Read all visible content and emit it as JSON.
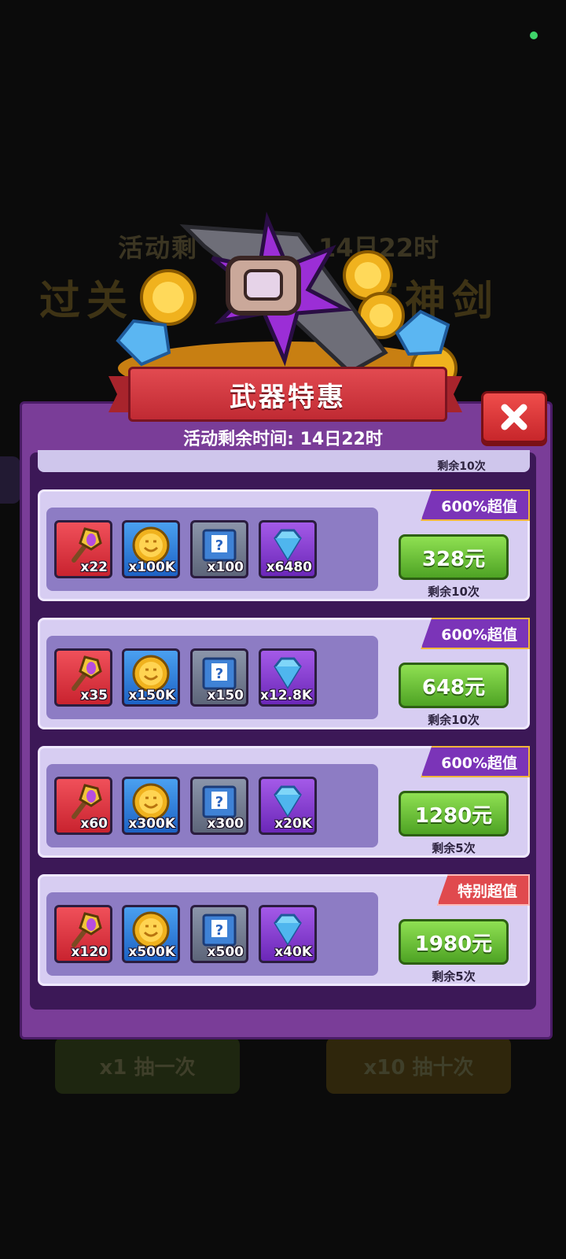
{
  "background": {
    "event_subtitle_left": "活动剩",
    "event_subtitle_right": "14日22时",
    "event_title_left": "过关",
    "event_title_right": "享神剑",
    "draw_one_label": "x1 抽一次",
    "draw_ten_label": "x10 抽十次"
  },
  "dialog": {
    "title": "武器特惠",
    "timer_text": "活动剩余时间: 14日22时",
    "partial_top_remaining": "剩余10次",
    "offers": [
      {
        "badge": "600%超值",
        "items": [
          {
            "icon": "staff-icon",
            "qty": "x22"
          },
          {
            "icon": "coin-icon",
            "qty": "x100K"
          },
          {
            "icon": "mystery-scroll-icon",
            "qty": "x100"
          },
          {
            "icon": "diamond-icon",
            "qty": "x6480"
          }
        ],
        "price": "328元",
        "remaining": "剩余10次"
      },
      {
        "badge": "600%超值",
        "items": [
          {
            "icon": "staff-icon",
            "qty": "x35"
          },
          {
            "icon": "coin-icon",
            "qty": "x150K"
          },
          {
            "icon": "mystery-scroll-icon",
            "qty": "x150"
          },
          {
            "icon": "diamond-icon",
            "qty": "x12.8K"
          }
        ],
        "price": "648元",
        "remaining": "剩余10次"
      },
      {
        "badge": "600%超值",
        "items": [
          {
            "icon": "staff-icon",
            "qty": "x60"
          },
          {
            "icon": "coin-icon",
            "qty": "x300K"
          },
          {
            "icon": "mystery-scroll-icon",
            "qty": "x300"
          },
          {
            "icon": "diamond-icon",
            "qty": "x20K"
          }
        ],
        "price": "1280元",
        "remaining": "剩余5次"
      },
      {
        "badge": "特别超值",
        "items": [
          {
            "icon": "staff-icon",
            "qty": "x120"
          },
          {
            "icon": "coin-icon",
            "qty": "x500K"
          },
          {
            "icon": "mystery-scroll-icon",
            "qty": "x500"
          },
          {
            "icon": "diamond-icon",
            "qty": "x40K"
          }
        ],
        "price": "1980元",
        "remaining": "剩余5次"
      }
    ]
  }
}
